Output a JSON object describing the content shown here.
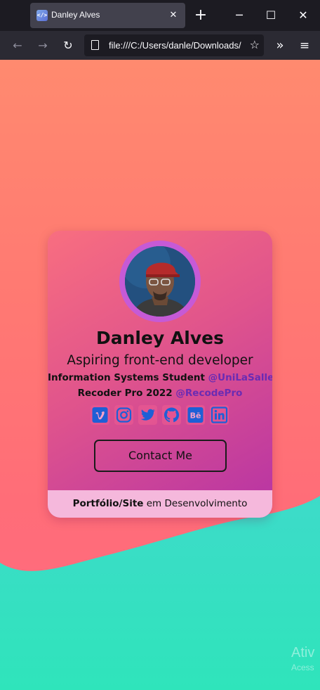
{
  "browser": {
    "tab_title": "Danley Alves",
    "favicon_text": "</>",
    "close_glyph": "✕",
    "newtab_glyph": "+",
    "url": "file:///C:/Users/danle/Downloads/",
    "min_glyph": "─",
    "max_glyph": "☐",
    "winclose_glyph": "✕",
    "back_glyph": "←",
    "fwd_glyph": "→",
    "reload_glyph": "↻",
    "star_glyph": "☆",
    "ext_glyph": "»",
    "menu_glyph": "≡"
  },
  "profile": {
    "name": "Danley Alves",
    "tagline": "Aspiring front-end developer",
    "line1_text": "Information Systems Student ",
    "line1_handle": "@UniLaSalle",
    "line2_text": "Recoder Pro 2022 ",
    "line2_handle": "@RecodePro",
    "socials": [
      {
        "name": "vimeo-icon"
      },
      {
        "name": "instagram-icon"
      },
      {
        "name": "twitter-icon"
      },
      {
        "name": "github-icon"
      },
      {
        "name": "behance-icon"
      },
      {
        "name": "linkedin-icon"
      }
    ],
    "contact_label": "Contact Me",
    "footer_bold": "Portfólio/Site",
    "footer_rest": " em Desenvolvimento"
  },
  "watermark": {
    "line1": "Ativ",
    "line2": "Acess"
  },
  "colors": {
    "bg_top": "#ff8a6f",
    "bg_bottom": "#ff6a82",
    "wave": "#33dcc2",
    "card_start": "#f86e80",
    "card_end": "#b633a5",
    "handle": "#6a2bb3",
    "icon_blue": "#1e5fd6",
    "footer_bg": "#f5b8dc",
    "avatar_ring": "#c65ad6"
  }
}
